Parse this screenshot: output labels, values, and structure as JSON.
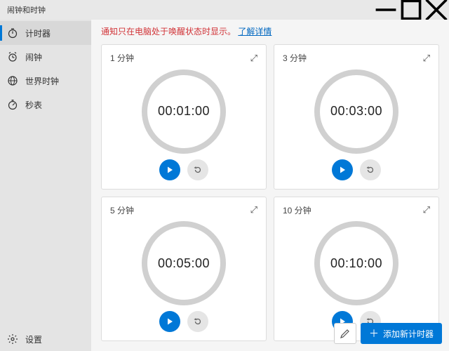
{
  "window": {
    "title": "闹钟和时钟"
  },
  "sidebar": {
    "items": [
      {
        "label": "计时器",
        "icon": "timer"
      },
      {
        "label": "闹钟",
        "icon": "alarm"
      },
      {
        "label": "世界时钟",
        "icon": "world"
      },
      {
        "label": "秒表",
        "icon": "stopwatch"
      }
    ],
    "settings_label": "设置"
  },
  "notice": {
    "text": "通知只在电脑处于唤醒状态时显示。",
    "link": "了解详情"
  },
  "timers": [
    {
      "label": "1 分钟",
      "time": "00:01:00"
    },
    {
      "label": "3 分钟",
      "time": "00:03:00"
    },
    {
      "label": "5 分钟",
      "time": "00:05:00"
    },
    {
      "label": "10 分钟",
      "time": "00:10:00"
    }
  ],
  "buttons": {
    "add_timer": "添加新计时器"
  },
  "colors": {
    "accent": "#0078d7",
    "warn": "#d13438"
  }
}
